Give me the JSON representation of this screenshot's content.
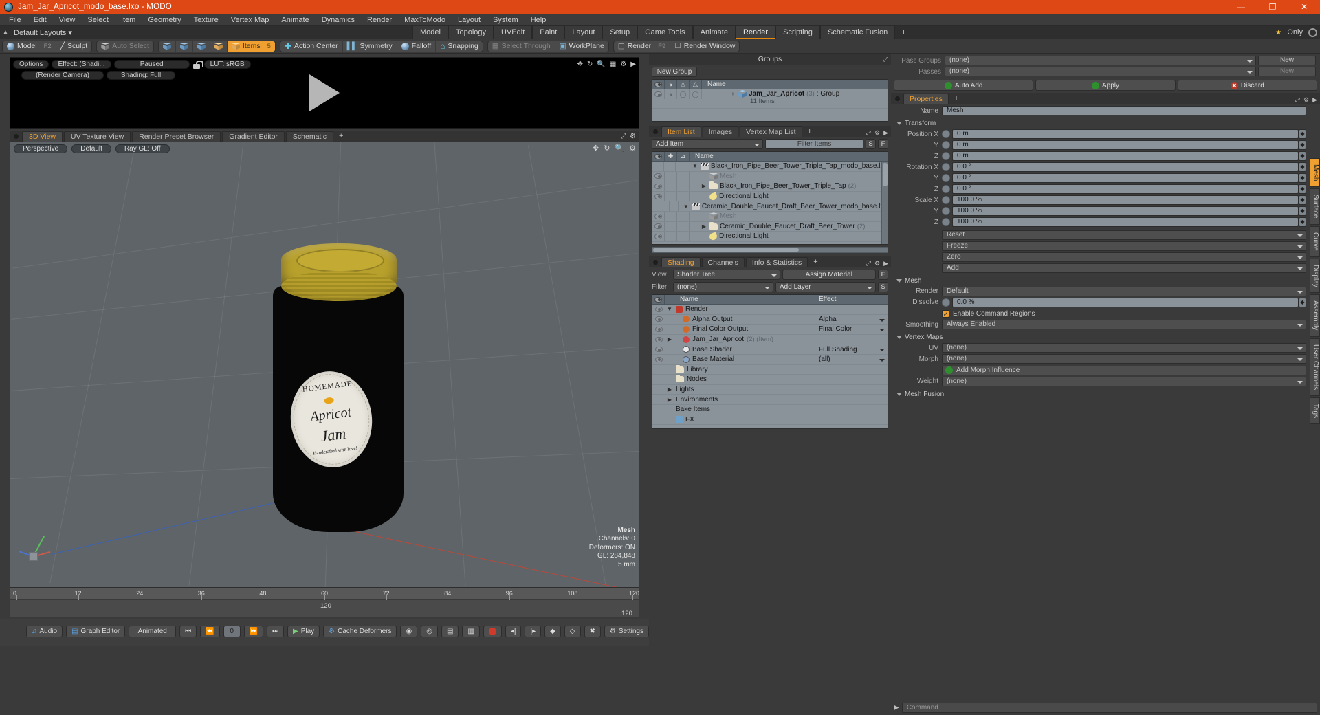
{
  "titlebar": {
    "title": "Jam_Jar_Apricot_modo_base.lxo - MODO",
    "minimize": "—",
    "maximize": "❐",
    "close": "✕",
    "accent": "#dd4814"
  },
  "menubar": [
    "File",
    "Edit",
    "View",
    "Select",
    "Item",
    "Geometry",
    "Texture",
    "Vertex Map",
    "Animate",
    "Dynamics",
    "Render",
    "MaxToModo",
    "Layout",
    "System",
    "Help"
  ],
  "layoutbar": {
    "layouts_label": "Default Layouts",
    "tabs": [
      "Model",
      "Topology",
      "UVEdit",
      "Paint",
      "Layout",
      "Setup",
      "Game Tools",
      "Animate",
      "Render",
      "Scripting",
      "Schematic Fusion"
    ],
    "active_tab": "Render",
    "plus": "+",
    "only_label": "Only",
    "star": "★"
  },
  "toolbar": {
    "mode_model": "Model",
    "mode_model_hotkey": "F2",
    "mode_sculpt": "Sculpt",
    "auto_select": "Auto Select",
    "items": "Items",
    "items_hotkey": "5",
    "action_center": "Action Center",
    "symmetry": "Symmetry",
    "falloff": "Falloff",
    "snapping": "Snapping",
    "select_through": "Select Through",
    "workplane": "WorkPlane",
    "render": "Render",
    "render_hotkey": "F9",
    "render_window": "Render Window"
  },
  "render_pane": {
    "options": "Options",
    "effect": "Effect: (Shadi...",
    "paused": "Paused",
    "lut": "LUT: sRGB",
    "camera": "(Render Camera)",
    "shading": "Shading: Full"
  },
  "view_tabs": {
    "tabs": [
      "3D View",
      "UV Texture View",
      "Render Preset Browser",
      "Gradient Editor",
      "Schematic"
    ],
    "active": "3D View",
    "plus": "+"
  },
  "viewport": {
    "perspective": "Perspective",
    "default": "Default",
    "raygl": "Ray GL: Off",
    "stats_title": "Mesh",
    "stats_channels": "Channels: 0",
    "stats_deformers": "Deformers: ON",
    "stats_gl": "GL: 284,848",
    "stats_size": "5 mm",
    "jar_label": {
      "line1": "HOMEMADE",
      "line2": "Apricot",
      "line3": "Jam",
      "line4": "Handcrafted with love!"
    }
  },
  "timeline": {
    "ticks": [
      "0",
      "12",
      "24",
      "36",
      "48",
      "60",
      "72",
      "84",
      "96",
      "108",
      "120"
    ],
    "center_value": "120",
    "right_value": "120"
  },
  "statusbar": {
    "audio": "Audio",
    "graph_editor": "Graph Editor",
    "animated": "Animated",
    "frame": "0",
    "play": "Play",
    "cache_deformers": "Cache Deformers",
    "settings": "Settings"
  },
  "groups_panel": {
    "title": "Groups",
    "new_group": "New Group",
    "col_name": "Name",
    "rows": [
      {
        "name": "Jam_Jar_Apricot",
        "count": "(3)",
        "type": ": Group",
        "sub": "11 Items"
      }
    ]
  },
  "item_list_panel": {
    "tabs": [
      "Item List",
      "Images",
      "Vertex Map List"
    ],
    "active": "Item List",
    "plus": "+",
    "add_item": "Add Item",
    "filter_placeholder": "Filter Items",
    "btn_s": "S",
    "btn_f": "F",
    "col_name": "Name",
    "rows": [
      {
        "name": "Black_Iron_Pipe_Beer_Tower_Triple_Tap_modo_base.lxo",
        "icon": "clapper-icon",
        "indent": 0,
        "tri": "▼",
        "count": "",
        "dim": false,
        "eye": false
      },
      {
        "name": "Mesh",
        "icon": "mesh-icon",
        "indent": 1,
        "tri": "",
        "count": "",
        "dim": true,
        "eye": true
      },
      {
        "name": "Black_Iron_Pipe_Beer_Tower_Triple_Tap",
        "icon": "folder-icon",
        "indent": 1,
        "tri": "▶",
        "count": "(2)",
        "dim": false,
        "eye": true
      },
      {
        "name": "Directional Light",
        "icon": "light-icon",
        "indent": 1,
        "tri": "",
        "count": "",
        "dim": false,
        "eye": true
      },
      {
        "name": "Ceramic_Double_Faucet_Draft_Beer_Tower_modo_base.lxo",
        "icon": "clapper-icon",
        "indent": 0,
        "tri": "▼",
        "count": "",
        "dim": false,
        "eye": false
      },
      {
        "name": "Mesh",
        "icon": "mesh-icon",
        "indent": 1,
        "tri": "",
        "count": "",
        "dim": true,
        "eye": true
      },
      {
        "name": "Ceramic_Double_Faucet_Draft_Beer_Tower",
        "icon": "folder-icon",
        "indent": 1,
        "tri": "▶",
        "count": "(2)",
        "dim": false,
        "eye": true
      },
      {
        "name": "Directional Light",
        "icon": "light-icon",
        "indent": 1,
        "tri": "",
        "count": "",
        "dim": false,
        "eye": true
      }
    ]
  },
  "shading_panel": {
    "tabs": [
      "Shading",
      "Channels",
      "Info & Statistics"
    ],
    "active": "Shading",
    "plus": "+",
    "view_label": "View",
    "view_value": "Shader Tree",
    "assign_material": "Assign Material",
    "assign_f": "F",
    "filter_label": "Filter",
    "filter_value": "(none)",
    "add_layer": "Add Layer",
    "add_s": "S",
    "col_name": "Name",
    "col_effect": "Effect",
    "rows": [
      {
        "name": "Render",
        "effect": "",
        "indent": 0,
        "tri": "▼",
        "eye": true,
        "icon": "render-icon"
      },
      {
        "name": "Alpha Output",
        "effect": "Alpha",
        "indent": 1,
        "tri": "",
        "eye": true,
        "icon": "output-icon"
      },
      {
        "name": "Final Color Output",
        "effect": "Final Color",
        "indent": 1,
        "tri": "",
        "eye": true,
        "icon": "output-icon"
      },
      {
        "name": "Jam_Jar_Apricot",
        "effect": "",
        "indent": 1,
        "tri": "▶",
        "eye": true,
        "icon": "group-icon",
        "count": "(2) (Item)"
      },
      {
        "name": "Base Shader",
        "effect": "Full Shading",
        "indent": 1,
        "tri": "",
        "eye": true,
        "icon": "shader-icon"
      },
      {
        "name": "Base Material",
        "effect": "(all)",
        "indent": 1,
        "tri": "",
        "eye": true,
        "icon": "material-icon"
      },
      {
        "name": "Library",
        "effect": "",
        "indent": 0,
        "tri": "",
        "eye": false,
        "icon": "folder-icon"
      },
      {
        "name": "Nodes",
        "effect": "",
        "indent": 0,
        "tri": "",
        "eye": false,
        "icon": "folder-icon"
      },
      {
        "name": "Lights",
        "effect": "",
        "indent": 0,
        "tri": "▶",
        "eye": false,
        "icon": ""
      },
      {
        "name": "Environments",
        "effect": "",
        "indent": 0,
        "tri": "▶",
        "eye": false,
        "icon": ""
      },
      {
        "name": "Bake Items",
        "effect": "",
        "indent": 0,
        "tri": "",
        "eye": false,
        "icon": ""
      },
      {
        "name": "FX",
        "effect": "",
        "indent": 0,
        "tri": "",
        "eye": false,
        "icon": "fx-icon"
      }
    ]
  },
  "passes_panel": {
    "pass_groups_label": "Pass Groups",
    "pass_groups_value": "(none)",
    "pass_groups_new": "New",
    "passes_label": "Passes",
    "passes_value": "(none)",
    "passes_new": "New",
    "auto_add": "Auto Add",
    "apply": "Apply",
    "discard": "Discard"
  },
  "properties_panel": {
    "tabs": [
      "Properties"
    ],
    "active": "Properties",
    "plus": "+",
    "name_label": "Name",
    "name_value": "Mesh",
    "transform_section": "Transform",
    "transform": [
      {
        "label": "Position X",
        "value": "0 m"
      },
      {
        "label": "Y",
        "value": "0 m"
      },
      {
        "label": "Z",
        "value": "0 m"
      },
      {
        "label": "Rotation X",
        "value": "0.0 °"
      },
      {
        "label": "Y",
        "value": "0.0 °"
      },
      {
        "label": "Z",
        "value": "0.0 °"
      },
      {
        "label": "Scale X",
        "value": "100.0 %"
      },
      {
        "label": "Y",
        "value": "100.0 %"
      },
      {
        "label": "Z",
        "value": "100.0 %"
      }
    ],
    "transform_actions": [
      "Reset",
      "Freeze",
      "Zero",
      "Add"
    ],
    "mesh_section": "Mesh",
    "mesh": [
      {
        "label": "Render",
        "value": "Default",
        "type": "dropdown"
      },
      {
        "label": "Dissolve",
        "value": "0.0 %",
        "type": "field"
      }
    ],
    "enable_command_regions": "Enable Command Regions",
    "smoothing_label": "Smoothing",
    "smoothing_value": "Always Enabled",
    "vertex_maps_section": "Vertex Maps",
    "vertex_maps": [
      {
        "label": "UV",
        "value": "(none)"
      },
      {
        "label": "Morph",
        "value": "(none)"
      }
    ],
    "add_morph_influence": "Add Morph Influence",
    "weight_label": "Weight",
    "weight_value": "(none)",
    "mesh_fusion_section": "Mesh Fusion",
    "side_tabs": [
      "Mesh",
      "Surface",
      "Curve",
      "Display",
      "Assembly",
      "User Channels",
      "Tags"
    ],
    "side_tab_active": "Mesh"
  },
  "command_bar": {
    "placeholder": "Command",
    "arrow": "▶"
  }
}
